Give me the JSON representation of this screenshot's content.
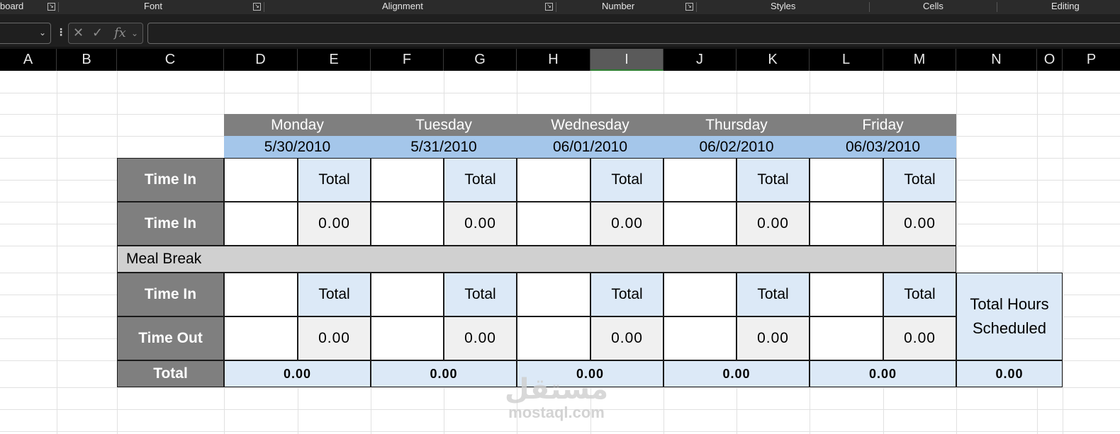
{
  "ribbon": {
    "groups": [
      "board",
      "Font",
      "Alignment",
      "Number",
      "Styles",
      "Cells",
      "Editing"
    ]
  },
  "formula_bar": {
    "cancel_icon": "close-icon",
    "enter_icon": "check-icon",
    "fx_label": "fx",
    "formula_value": ""
  },
  "columns": [
    "A",
    "B",
    "C",
    "D",
    "E",
    "F",
    "G",
    "H",
    "I",
    "J",
    "K",
    "L",
    "M",
    "N",
    "O",
    "P"
  ],
  "selected_column": "I",
  "timesheet": {
    "days": [
      {
        "name": "Monday",
        "date": "5/30/2010"
      },
      {
        "name": "Tuesday",
        "date": "5/31/2010"
      },
      {
        "name": "Wednesday",
        "date": "06/01/2010"
      },
      {
        "name": "Thursday",
        "date": "06/02/2010"
      },
      {
        "name": "Friday",
        "date": "06/03/2010"
      }
    ],
    "row_labels": {
      "r1": "Time In",
      "r2": "Time In",
      "r3": "Time In",
      "r4": "Time Out",
      "total": "Total"
    },
    "total_label": "Total",
    "zero_value": "0.00",
    "meal_break": "Meal Break",
    "day_totals": [
      "0.00",
      "0.00",
      "0.00",
      "0.00",
      "0.00"
    ],
    "total_hours_label_line1": "Total Hours",
    "total_hours_label_line2": "Scheduled",
    "total_hours_value": "0.00"
  },
  "watermark": {
    "logo_text": "مستقل",
    "url": "mostaql.com"
  },
  "colors": {
    "header_gray": "#7f7f7f",
    "date_blue": "#a4c6ea",
    "light_blue": "#dce9f7",
    "meal_gray": "#d0d0d0"
  }
}
